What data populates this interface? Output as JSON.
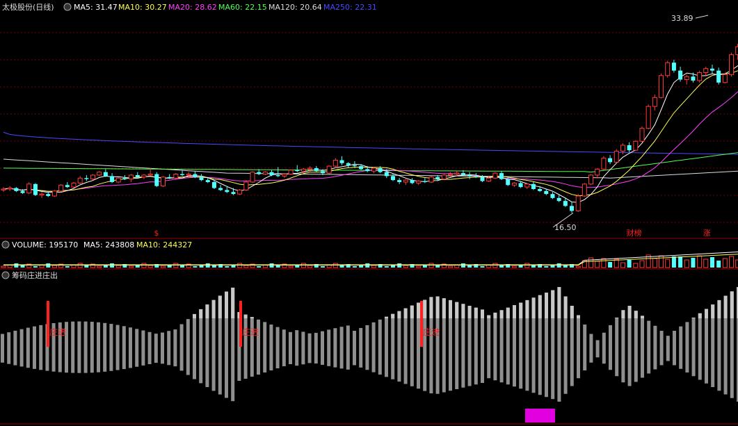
{
  "theme": {
    "background": "#000000",
    "up": "#ff3b3b",
    "down": "#54ffff",
    "grid": "#7a0000",
    "separator": "#a00000",
    "text": "#dcdcdc",
    "accent_red": "#ff2020",
    "magenta_block": "#e000e0"
  },
  "legend": {
    "title": "太极股份(日线)",
    "ma": [
      {
        "text": "MA5: 31.47",
        "color": "#ffffff"
      },
      {
        "text": "MA10: 30.27",
        "color": "#ffff55"
      },
      {
        "text": "MA20: 28.62",
        "color": "#ff40ff"
      },
      {
        "text": "MA60: 22.15",
        "color": "#55ff55"
      },
      {
        "text": "MA120: 20.64",
        "color": "#dddddd"
      },
      {
        "text": "MA250: 22.31",
        "color": "#4a4aff"
      }
    ]
  },
  "volume_legend": [
    {
      "text": "VOLUME: 195170",
      "color": "#ffffff"
    },
    {
      "text": "MA5: 243808",
      "color": "#ffffff"
    },
    {
      "text": "MA10: 244327",
      "color": "#ffff55"
    }
  ],
  "indicator_legend": {
    "title": "筹码庄进庄出"
  },
  "annotations": {
    "high_label": "33.89",
    "low_label": "16.50",
    "markers": [
      {
        "text": "$",
        "index": 24
      },
      {
        "text": "财榜",
        "index": 98
      },
      {
        "text": "涨",
        "index": 110
      }
    ],
    "entry_label": "庄进",
    "entry_indices": [
      7,
      37,
      66
    ]
  },
  "chart_data": {
    "type": "candlestick",
    "price_range": [
      14.5,
      36.5
    ],
    "ohlc": [
      [
        18.8,
        19.1,
        18.6,
        18.9
      ],
      [
        18.9,
        19.2,
        18.7,
        19.0
      ],
      [
        19.0,
        19.1,
        18.6,
        18.7
      ],
      [
        18.7,
        18.9,
        18.4,
        18.5
      ],
      [
        18.5,
        19.6,
        18.4,
        19.4
      ],
      [
        19.4,
        19.5,
        18.2,
        18.3
      ],
      [
        18.3,
        18.6,
        18.0,
        18.4
      ],
      [
        18.4,
        18.7,
        18.1,
        18.2
      ],
      [
        18.2,
        18.8,
        18.1,
        18.7
      ],
      [
        18.7,
        19.4,
        18.6,
        19.3
      ],
      [
        19.3,
        19.6,
        19.0,
        19.1
      ],
      [
        19.1,
        19.6,
        19.0,
        19.5
      ],
      [
        19.5,
        20.2,
        19.4,
        20.0
      ],
      [
        20.0,
        20.3,
        19.7,
        19.9
      ],
      [
        19.9,
        20.4,
        19.8,
        20.3
      ],
      [
        20.3,
        20.7,
        20.2,
        20.6
      ],
      [
        20.6,
        20.9,
        20.1,
        20.2
      ],
      [
        20.2,
        20.5,
        19.5,
        19.6
      ],
      [
        19.6,
        20.1,
        19.5,
        20.0
      ],
      [
        20.0,
        20.3,
        19.8,
        19.9
      ],
      [
        19.9,
        20.4,
        19.6,
        20.3
      ],
      [
        20.3,
        20.6,
        20.0,
        20.1
      ],
      [
        20.1,
        20.4,
        19.9,
        20.3
      ],
      [
        20.3,
        21.0,
        20.2,
        20.4
      ],
      [
        20.4,
        20.6,
        19.1,
        19.2
      ],
      [
        19.2,
        20.2,
        19.1,
        20.1
      ],
      [
        20.1,
        20.4,
        19.9,
        20.0
      ],
      [
        20.0,
        20.5,
        19.8,
        20.4
      ],
      [
        20.4,
        20.8,
        20.2,
        20.3
      ],
      [
        20.3,
        20.6,
        20.1,
        20.4
      ],
      [
        20.4,
        20.7,
        20.0,
        20.1
      ],
      [
        20.1,
        20.4,
        19.7,
        19.8
      ],
      [
        19.8,
        20.0,
        19.5,
        19.6
      ],
      [
        19.6,
        19.8,
        18.9,
        19.0
      ],
      [
        19.0,
        19.3,
        18.7,
        18.8
      ],
      [
        18.8,
        19.2,
        18.5,
        18.6
      ],
      [
        18.6,
        19.0,
        18.3,
        18.4
      ],
      [
        18.4,
        18.9,
        18.3,
        18.8
      ],
      [
        18.8,
        19.8,
        18.7,
        19.6
      ],
      [
        19.6,
        20.7,
        19.5,
        20.6
      ],
      [
        20.6,
        20.9,
        20.3,
        20.4
      ],
      [
        20.4,
        20.7,
        20.3,
        20.6
      ],
      [
        20.6,
        20.8,
        20.2,
        20.3
      ],
      [
        20.3,
        21.1,
        20.1,
        20.2
      ],
      [
        20.2,
        20.5,
        20.0,
        20.4
      ],
      [
        20.4,
        20.9,
        20.3,
        20.8
      ],
      [
        20.8,
        21.3,
        20.6,
        20.7
      ],
      [
        20.7,
        21.0,
        20.5,
        20.9
      ],
      [
        20.9,
        21.2,
        20.6,
        21.0
      ],
      [
        21.0,
        21.2,
        20.6,
        20.7
      ],
      [
        20.7,
        20.9,
        20.3,
        20.5
      ],
      [
        20.5,
        21.3,
        20.4,
        21.2
      ],
      [
        21.2,
        22.0,
        21.0,
        21.8
      ],
      [
        21.8,
        22.2,
        21.3,
        21.5
      ],
      [
        21.5,
        21.6,
        21.0,
        21.3
      ],
      [
        21.3,
        21.7,
        21.0,
        21.2
      ],
      [
        21.2,
        21.4,
        20.8,
        20.9
      ],
      [
        20.9,
        21.2,
        20.6,
        20.7
      ],
      [
        20.7,
        21.1,
        20.5,
        21.0
      ],
      [
        21.0,
        21.2,
        20.5,
        20.6
      ],
      [
        20.6,
        20.9,
        20.0,
        20.2
      ],
      [
        20.2,
        20.4,
        19.7,
        19.8
      ],
      [
        19.8,
        20.0,
        19.4,
        19.6
      ],
      [
        19.6,
        19.9,
        19.3,
        19.8
      ],
      [
        19.8,
        20.0,
        19.4,
        19.5
      ],
      [
        19.5,
        19.8,
        19.3,
        19.7
      ],
      [
        19.7,
        20.0,
        19.5,
        19.6
      ],
      [
        19.6,
        20.2,
        19.5,
        20.1
      ],
      [
        20.1,
        20.3,
        19.7,
        19.9
      ],
      [
        19.9,
        20.4,
        19.8,
        20.3
      ],
      [
        20.3,
        20.6,
        20.1,
        20.4
      ],
      [
        20.4,
        20.7,
        20.2,
        20.5
      ],
      [
        20.5,
        20.8,
        20.2,
        20.3
      ],
      [
        20.3,
        20.6,
        19.9,
        20.2
      ],
      [
        20.2,
        20.5,
        20.0,
        20.1
      ],
      [
        20.1,
        20.3,
        19.6,
        19.7
      ],
      [
        19.7,
        20.2,
        19.6,
        20.0
      ],
      [
        20.0,
        20.6,
        19.9,
        20.5
      ],
      [
        20.5,
        20.7,
        19.8,
        19.9
      ],
      [
        19.9,
        20.1,
        19.2,
        19.3
      ],
      [
        19.3,
        19.6,
        19.1,
        19.5
      ],
      [
        19.5,
        19.7,
        19.0,
        19.1
      ],
      [
        19.1,
        19.5,
        18.9,
        19.4
      ],
      [
        19.4,
        19.6,
        18.8,
        18.9
      ],
      [
        18.9,
        19.2,
        18.6,
        18.7
      ],
      [
        18.7,
        18.9,
        18.3,
        18.4
      ],
      [
        18.4,
        18.6,
        17.9,
        18.0
      ],
      [
        18.0,
        18.3,
        17.6,
        17.7
      ],
      [
        17.7,
        18.0,
        17.1,
        17.2
      ],
      [
        17.2,
        17.6,
        16.5,
        16.7
      ],
      [
        16.7,
        18.4,
        16.6,
        18.2
      ],
      [
        18.2,
        19.5,
        18.1,
        19.4
      ],
      [
        19.4,
        20.4,
        19.3,
        20.3
      ],
      [
        20.3,
        21.0,
        20.0,
        20.9
      ],
      [
        20.9,
        22.2,
        20.8,
        22.0
      ],
      [
        22.0,
        22.3,
        21.4,
        21.6
      ],
      [
        21.6,
        22.9,
        21.5,
        22.7
      ],
      [
        22.7,
        23.5,
        22.4,
        23.3
      ],
      [
        23.3,
        23.6,
        22.6,
        22.8
      ],
      [
        22.8,
        23.8,
        22.7,
        23.7
      ],
      [
        23.7,
        25.2,
        23.6,
        25.0
      ],
      [
        25.0,
        27.4,
        24.9,
        27.2
      ],
      [
        27.2,
        28.4,
        26.8,
        28.1
      ],
      [
        28.1,
        30.5,
        28.0,
        30.3
      ],
      [
        30.3,
        31.8,
        30.1,
        31.6
      ],
      [
        31.6,
        31.9,
        30.6,
        30.8
      ],
      [
        30.8,
        31.2,
        29.7,
        29.9
      ],
      [
        29.9,
        30.4,
        29.4,
        30.2
      ],
      [
        30.2,
        30.6,
        29.6,
        29.8
      ],
      [
        29.8,
        30.8,
        29.6,
        30.6
      ],
      [
        30.6,
        31.2,
        30.2,
        31.0
      ],
      [
        31.0,
        31.4,
        30.5,
        30.8
      ],
      [
        30.8,
        31.1,
        29.4,
        29.6
      ],
      [
        29.6,
        30.6,
        29.5,
        30.4
      ],
      [
        30.4,
        32.6,
        30.2,
        32.4
      ],
      [
        32.4,
        33.5,
        31.9,
        33.2
      ],
      [
        33.2,
        33.8,
        32.1,
        32.4
      ],
      [
        32.4,
        33.89,
        31.8,
        33.4
      ],
      [
        33.4,
        33.6,
        32.6,
        32.8
      ],
      [
        32.8,
        33.5,
        31.6,
        31.9
      ]
    ]
  }
}
